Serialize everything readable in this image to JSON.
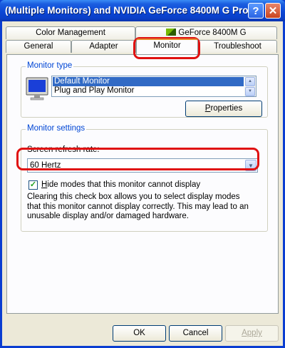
{
  "window": {
    "title": "(Multiple Monitors) and NVIDIA GeForce 8400M G Pro...",
    "help_glyph": "?",
    "close_glyph": "✕"
  },
  "tabs": {
    "row_back": [
      {
        "label": "Color Management"
      },
      {
        "label": "GeForce 8400M G"
      }
    ],
    "row_front": [
      {
        "label": "General"
      },
      {
        "label": "Adapter"
      },
      {
        "label": "Monitor"
      },
      {
        "label": "Troubleshoot"
      }
    ],
    "active": "Monitor"
  },
  "monitor_type": {
    "group_label": "Monitor type",
    "items": [
      "Default Monitor",
      "Plug and Play Monitor"
    ],
    "selected": "Default Monitor",
    "properties_button": {
      "label_mnemonic": "P",
      "label_rest": "roperties"
    }
  },
  "monitor_settings": {
    "group_label": "Monitor settings",
    "refresh_label": "Screen refresh rate:",
    "refresh_value": "60 Hertz",
    "hide_modes_checked": true,
    "hide_modes_label_mnemonic": "H",
    "hide_modes_label_rest": "ide modes that this monitor cannot display",
    "help_text": "Clearing this check box allows you to select display modes that this monitor cannot display correctly. This may lead to an unusable display and/or damaged hardware."
  },
  "buttons": {
    "ok": "OK",
    "cancel": "Cancel",
    "apply": "Apply"
  },
  "annotation_color": "#e01010"
}
